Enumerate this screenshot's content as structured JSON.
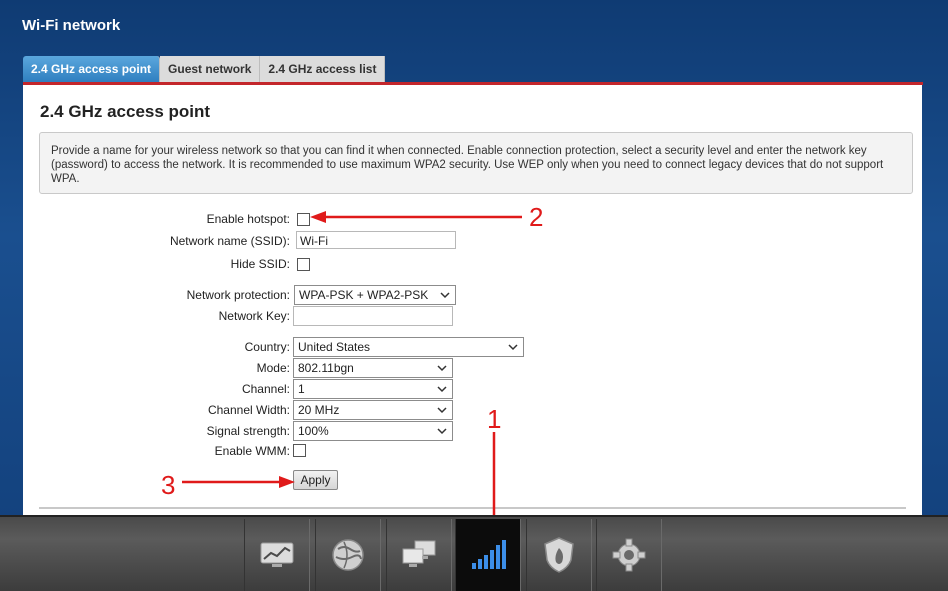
{
  "header": {
    "title": "Wi-Fi network"
  },
  "tabs": [
    {
      "label": "2.4 GHz access point",
      "active": true
    },
    {
      "label": "Guest network",
      "active": false
    },
    {
      "label": "2.4 GHz access list",
      "active": false
    }
  ],
  "section": {
    "title": "2.4 GHz access point",
    "info": "Provide a name for your wireless network so that you can find it when connected. Enable connection protection, select a security level and enter the network key (password) to access the network. It is recommended to use maximum WPA2 security. Use WEP only when you need to connect legacy devices that do not support WPA."
  },
  "form": {
    "enable_hotspot_label": "Enable hotspot:",
    "enable_hotspot_checked": false,
    "ssid_label": "Network name (SSID):",
    "ssid_value": "Wi-Fi",
    "hide_ssid_label": "Hide SSID:",
    "hide_ssid_checked": false,
    "protection_label": "Network protection:",
    "protection_value": "WPA-PSK + WPA2-PSK",
    "key_label": "Network Key:",
    "key_value": "",
    "country_label": "Country:",
    "country_value": "United States",
    "mode_label": "Mode:",
    "mode_value": "802.11bgn",
    "channel_label": "Channel:",
    "channel_value": "1",
    "width_label": "Channel Width:",
    "width_value": "20 MHz",
    "signal_label": "Signal strength:",
    "signal_value": "100%",
    "wmm_label": "Enable WMM:",
    "wmm_checked": false,
    "apply_label": "Apply"
  },
  "annotations": {
    "one": "1",
    "two": "2",
    "three": "3",
    "color": "#e01a1a"
  },
  "bottom_nav": [
    {
      "icon": "monitor-chart-icon",
      "active": false
    },
    {
      "icon": "globe-icon",
      "active": false
    },
    {
      "icon": "network-computers-icon",
      "active": false
    },
    {
      "icon": "wifi-signal-bars-icon",
      "active": true
    },
    {
      "icon": "security-shield-icon",
      "active": false
    },
    {
      "icon": "gear-icon",
      "active": false
    }
  ],
  "colors": {
    "accent": "#2f7fc0",
    "tab_underline": "#c3262b",
    "background": "#1a4f8f"
  }
}
